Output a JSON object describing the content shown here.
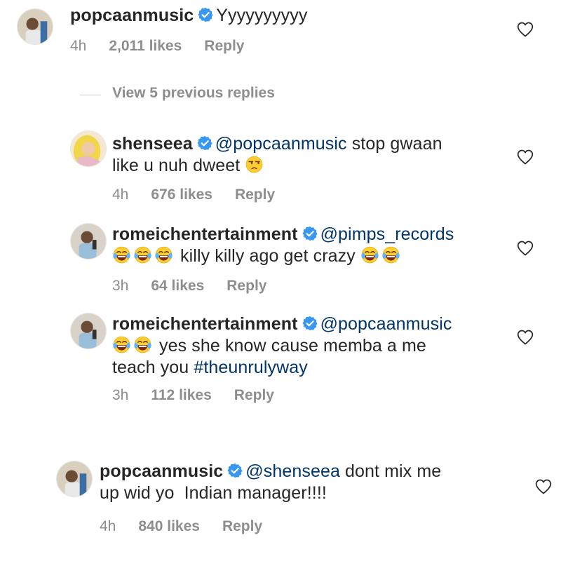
{
  "comments": [
    {
      "username": "popcaanmusic",
      "text": "Yyyyyyyyyy",
      "time": "4h",
      "likes": "2,011 likes",
      "reply": "Reply"
    },
    {
      "username": "shenseea",
      "mention": "@popcaanmusic",
      "text_1": "stop gwaan",
      "text_2": "like u nuh dweet",
      "emoji": "unamused-face-emoji",
      "time": "4h",
      "likes": "676 likes",
      "reply": "Reply"
    },
    {
      "username": "romeichentertainment",
      "mention": "@pimps_records",
      "text": "killy killy ago get crazy",
      "emoji": "face-with-tears-of-joy-emoji",
      "time": "3h",
      "likes": "64 likes",
      "reply": "Reply"
    },
    {
      "username": "romeichentertainment",
      "mention": "@popcaanmusic",
      "text_1": "yes she know cause memba a me",
      "text_2": "teach you",
      "hashtag": "#theunrulyway",
      "emoji": "face-with-tears-of-joy-emoji",
      "time": "3h",
      "likes": "112 likes",
      "reply": "Reply"
    },
    {
      "username": "popcaanmusic",
      "mention": "@shenseea",
      "text_1": "dont mix me",
      "text_2": "up wid yo  Indian manager!!!!",
      "time": "4h",
      "likes": "840 likes",
      "reply": "Reply"
    }
  ],
  "view_replies": "View 5 previous replies",
  "icons": {
    "verified": "verified-badge-icon",
    "like": "heart-outline-icon"
  },
  "colors": {
    "verified_blue": "#3897f0",
    "link": "#003569",
    "secondary_text": "#8e8e8e",
    "primary_text": "#262626"
  }
}
